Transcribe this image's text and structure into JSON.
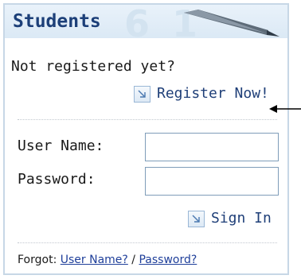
{
  "header": {
    "title": "Students",
    "decoration_text": "6 1"
  },
  "register": {
    "prompt": "Not registered yet?",
    "link_label": "Register Now!"
  },
  "login": {
    "username_label": "User Name:",
    "username_value": "",
    "password_label": "Password:",
    "password_value": "",
    "sign_in_label": "Sign In"
  },
  "footer": {
    "prefix": "Forgot:",
    "username_link": "User Name?",
    "separator": "/",
    "password_link": "Password?"
  },
  "colors": {
    "title": "#1c3f78",
    "link": "#1f3f78",
    "border": "#c7d7e6",
    "header_bg": "#dbe9f5"
  },
  "icons": [
    "pen-icon",
    "link-arrow-icon",
    "pointer-arrow-icon"
  ]
}
